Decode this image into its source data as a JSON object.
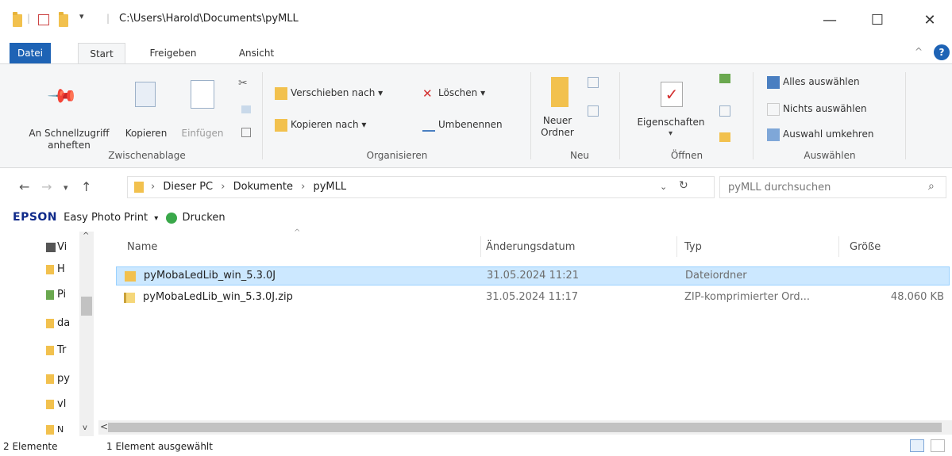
{
  "window": {
    "path": "C:\\Users\\Harold\\Documents\\pyMLL",
    "minimize": "—",
    "maximize": "☐",
    "close": "✕"
  },
  "ribbon_tabs": [
    "Datei",
    "Start",
    "Freigeben",
    "Ansicht"
  ],
  "ribbon": {
    "zwischenablage": {
      "label": "Zwischenablage",
      "pin_line1": "An Schnellzugriff",
      "pin_line2": "anheften",
      "copy": "Kopieren",
      "paste": "Einfügen"
    },
    "organisieren": {
      "label": "Organisieren",
      "move": "Verschieben nach ▾",
      "copy_to": "Kopieren nach ▾",
      "delete": "Löschen ▾",
      "rename": "Umbenennen"
    },
    "neu": {
      "label": "Neu",
      "new_folder_line1": "Neuer",
      "new_folder_line2": "Ordner"
    },
    "oeffnen": {
      "label": "Öffnen",
      "properties": "Eigenschaften"
    },
    "auswaehlen": {
      "label": "Auswählen",
      "select_all": "Alles auswählen",
      "select_none": "Nichts auswählen",
      "invert": "Auswahl umkehren"
    }
  },
  "address": {
    "crumbs": [
      "Dieser PC",
      "Dokumente",
      "pyMLL"
    ],
    "search_placeholder": "pyMLL durchsuchen"
  },
  "epson": {
    "brand": "EPSON",
    "app": "Easy Photo Print",
    "print": "Drucken"
  },
  "nav_items": [
    "Vi",
    "H",
    "Pi",
    "da",
    "Tr",
    "py",
    "vl",
    "N"
  ],
  "columns": {
    "name": "Name",
    "date": "Änderungsdatum",
    "type": "Typ",
    "size": "Größe"
  },
  "files": [
    {
      "name": "pyMobaLedLib_win_5.3.0J",
      "date": "31.05.2024 11:21",
      "type": "Dateiordner",
      "size": ""
    },
    {
      "name": "pyMobaLedLib_win_5.3.0J.zip",
      "date": "31.05.2024 11:17",
      "type": "ZIP-komprimierter Ord...",
      "size": "48.060 KB"
    }
  ],
  "status": {
    "count": "2 Elemente",
    "selected": "1 Element ausgewählt"
  }
}
